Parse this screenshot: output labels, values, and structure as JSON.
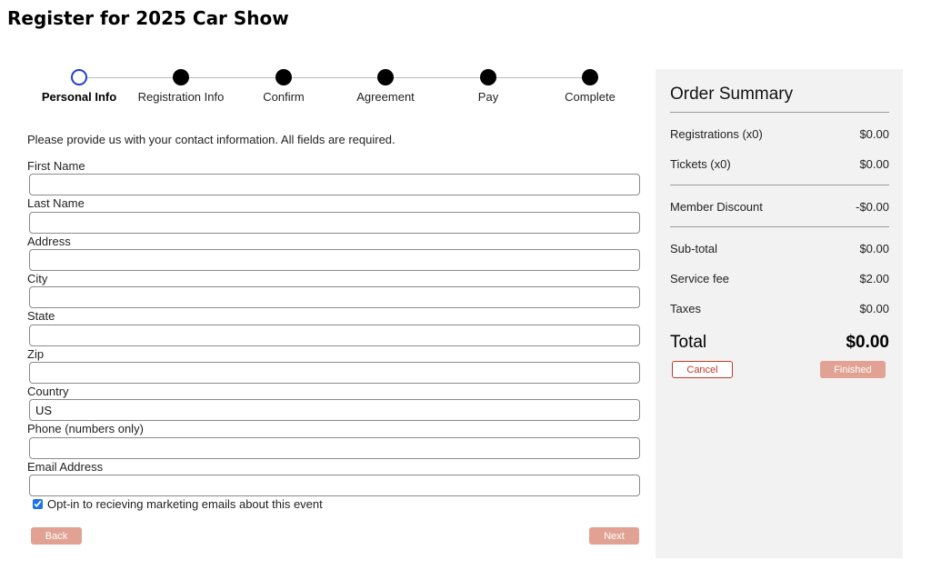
{
  "page": {
    "title": "Register for 2025 Car Show"
  },
  "stepper": {
    "steps": [
      {
        "label": "Personal Info",
        "state": "active"
      },
      {
        "label": "Registration Info",
        "state": "upcoming"
      },
      {
        "label": "Confirm",
        "state": "upcoming"
      },
      {
        "label": "Agreement",
        "state": "upcoming"
      },
      {
        "label": "Pay",
        "state": "upcoming"
      },
      {
        "label": "Complete",
        "state": "upcoming"
      }
    ]
  },
  "form": {
    "intro": "Please provide us with your contact information. All fields are required.",
    "fields": [
      {
        "label": "First Name",
        "value": ""
      },
      {
        "label": "Last Name",
        "value": ""
      },
      {
        "label": "Address",
        "value": ""
      },
      {
        "label": "City",
        "value": ""
      },
      {
        "label": "State",
        "value": ""
      },
      {
        "label": "Zip",
        "value": ""
      },
      {
        "label": "Country",
        "value": "US"
      },
      {
        "label": "Phone (numbers only)",
        "value": ""
      },
      {
        "label": "Email Address",
        "value": ""
      }
    ],
    "optin_label": "Opt-in to recieving marketing emails about this event",
    "optin_checked": true,
    "back_label": "Back",
    "next_label": "Next"
  },
  "summary": {
    "title": "Order Summary",
    "registrations_label": "Registrations (x0)",
    "registrations_amount": "$0.00",
    "tickets_label": "Tickets (x0)",
    "tickets_amount": "$0.00",
    "discount_label": "Member Discount",
    "discount_amount": "-$0.00",
    "subtotal_label": "Sub-total",
    "subtotal_amount": "$0.00",
    "service_fee_label": "Service fee",
    "service_fee_amount": "$2.00",
    "taxes_label": "Taxes",
    "taxes_amount": "$0.00",
    "total_label": "Total",
    "total_amount": "$0.00",
    "cancel_label": "Cancel",
    "finished_label": "Finished"
  },
  "colors": {
    "accent_button": "#e1a293",
    "active_step": "#1f3fd6",
    "cancel": "#c0392b",
    "panel_bg": "#f2f2f2"
  }
}
